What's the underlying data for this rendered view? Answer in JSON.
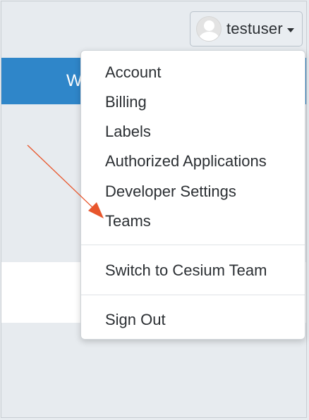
{
  "user_menu": {
    "username": "testuser",
    "avatar_icon": "default-user-avatar",
    "caret_icon": "caret-down-icon"
  },
  "banner": {
    "partial_text": "W",
    "color": "#2f86c9"
  },
  "dropdown": {
    "items": [
      "Account",
      "Billing",
      "Labels",
      "Authorized Applications",
      "Developer Settings",
      "Teams"
    ],
    "switch_team": "Switch to Cesium Team",
    "sign_out": "Sign Out"
  },
  "annotation": {
    "arrow_color": "#e8562c",
    "points_to": "Teams"
  }
}
